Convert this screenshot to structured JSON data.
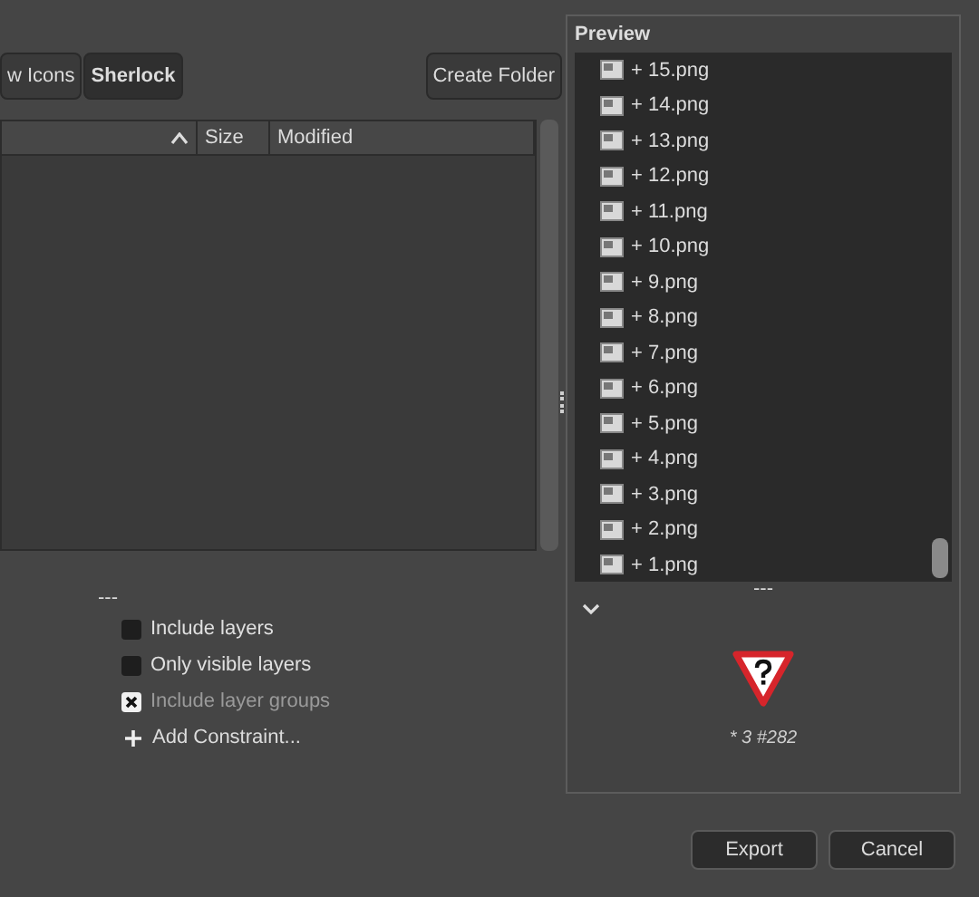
{
  "toolbar": {
    "buttons": [
      {
        "label": "w Icons",
        "selected": false
      },
      {
        "label": "Sherlock",
        "selected": true
      }
    ],
    "create_folder": "Create Folder"
  },
  "file_table": {
    "columns": [
      {
        "sorted": true
      },
      {
        "label": "Size",
        "sorted": false
      },
      {
        "label": "Modified",
        "sorted": false
      }
    ]
  },
  "options": {
    "separator": "---",
    "items": [
      {
        "label": "Include layers",
        "checked": false,
        "disabled": false
      },
      {
        "label": "Only visible layers",
        "checked": false,
        "disabled": false
      },
      {
        "label": "Include layer groups",
        "checked": true,
        "disabled": true
      }
    ],
    "add_constraint": "Add Constraint..."
  },
  "preview": {
    "title": "Preview",
    "layers": [
      {
        "label": "+ 15.png"
      },
      {
        "label": "+ 14.png"
      },
      {
        "label": "+ 13.png"
      },
      {
        "label": "+ 12.png"
      },
      {
        "label": "+ 11.png"
      },
      {
        "label": "+ 10.png"
      },
      {
        "label": "+ 9.png"
      },
      {
        "label": "+ 8.png"
      },
      {
        "label": "+ 7.png"
      },
      {
        "label": "+ 6.png"
      },
      {
        "label": "+ 5.png"
      },
      {
        "label": "+ 4.png"
      },
      {
        "label": "+ 3.png"
      },
      {
        "label": "+ 2.png"
      },
      {
        "label": "+ 1.png"
      }
    ],
    "separator": "---",
    "caption": "* 3 #282"
  },
  "buttons": [
    {
      "label": "Export"
    },
    {
      "label": "Cancel"
    }
  ]
}
